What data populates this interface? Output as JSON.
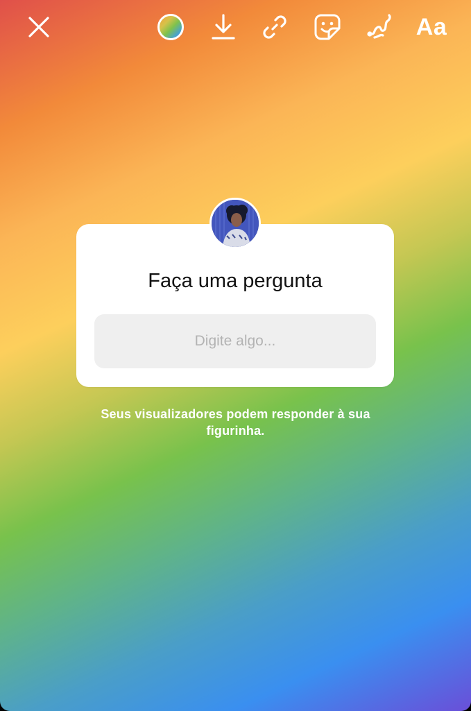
{
  "toolbar": {
    "close_icon": "close-icon",
    "color_icon": "gradient-color-wheel-icon",
    "download_icon": "download-icon",
    "link_icon": "link-icon",
    "sticker_icon": "sticker-icon",
    "draw_icon": "draw-squiggle-icon",
    "text_label": "Aa"
  },
  "sticker": {
    "avatar_icon": "profile-avatar",
    "title": "Faça uma pergunta",
    "input_value": "",
    "input_placeholder": "Digite algo..."
  },
  "hint": "Seus visualizadores podem responder à sua figurinha.",
  "colors": {
    "card_background": "#ffffff",
    "input_background": "#efefef",
    "placeholder": "#b3b3b3",
    "toolbar_foreground": "#ffffff"
  }
}
